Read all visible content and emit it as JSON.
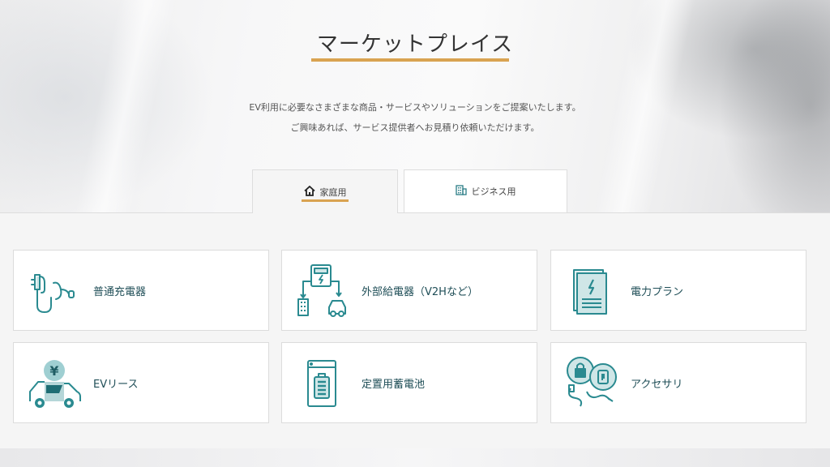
{
  "hero": {
    "title": "マーケットプレイス",
    "lead_line1": "EV利用に必要なさまざまな商品・サービスやソリューションをご提案いたします。",
    "lead_line2": "ご興味あれば、サービス提供者へお見積り依頼いただけます。"
  },
  "tabs": [
    {
      "label": "家庭用",
      "icon": "home-icon",
      "active": true
    },
    {
      "label": "ビジネス用",
      "icon": "building-icon",
      "active": false
    }
  ],
  "cards": [
    {
      "label": "普通充電器",
      "icon": "charger-plug-icon"
    },
    {
      "label": "外部給電器（V2Hなど）",
      "icon": "v2h-icon"
    },
    {
      "label": "電力プラン",
      "icon": "power-plan-document-icon"
    },
    {
      "label": "EVリース",
      "icon": "ev-lease-icon"
    },
    {
      "label": "定置用蓄電池",
      "icon": "storage-battery-icon"
    },
    {
      "label": "アクセサリ",
      "icon": "accessory-icon"
    }
  ],
  "colors": {
    "accent": "#d9a351",
    "icon_teal": "#2a8a90",
    "icon_fill": "#cfe6e7",
    "label": "#1f4e57"
  }
}
